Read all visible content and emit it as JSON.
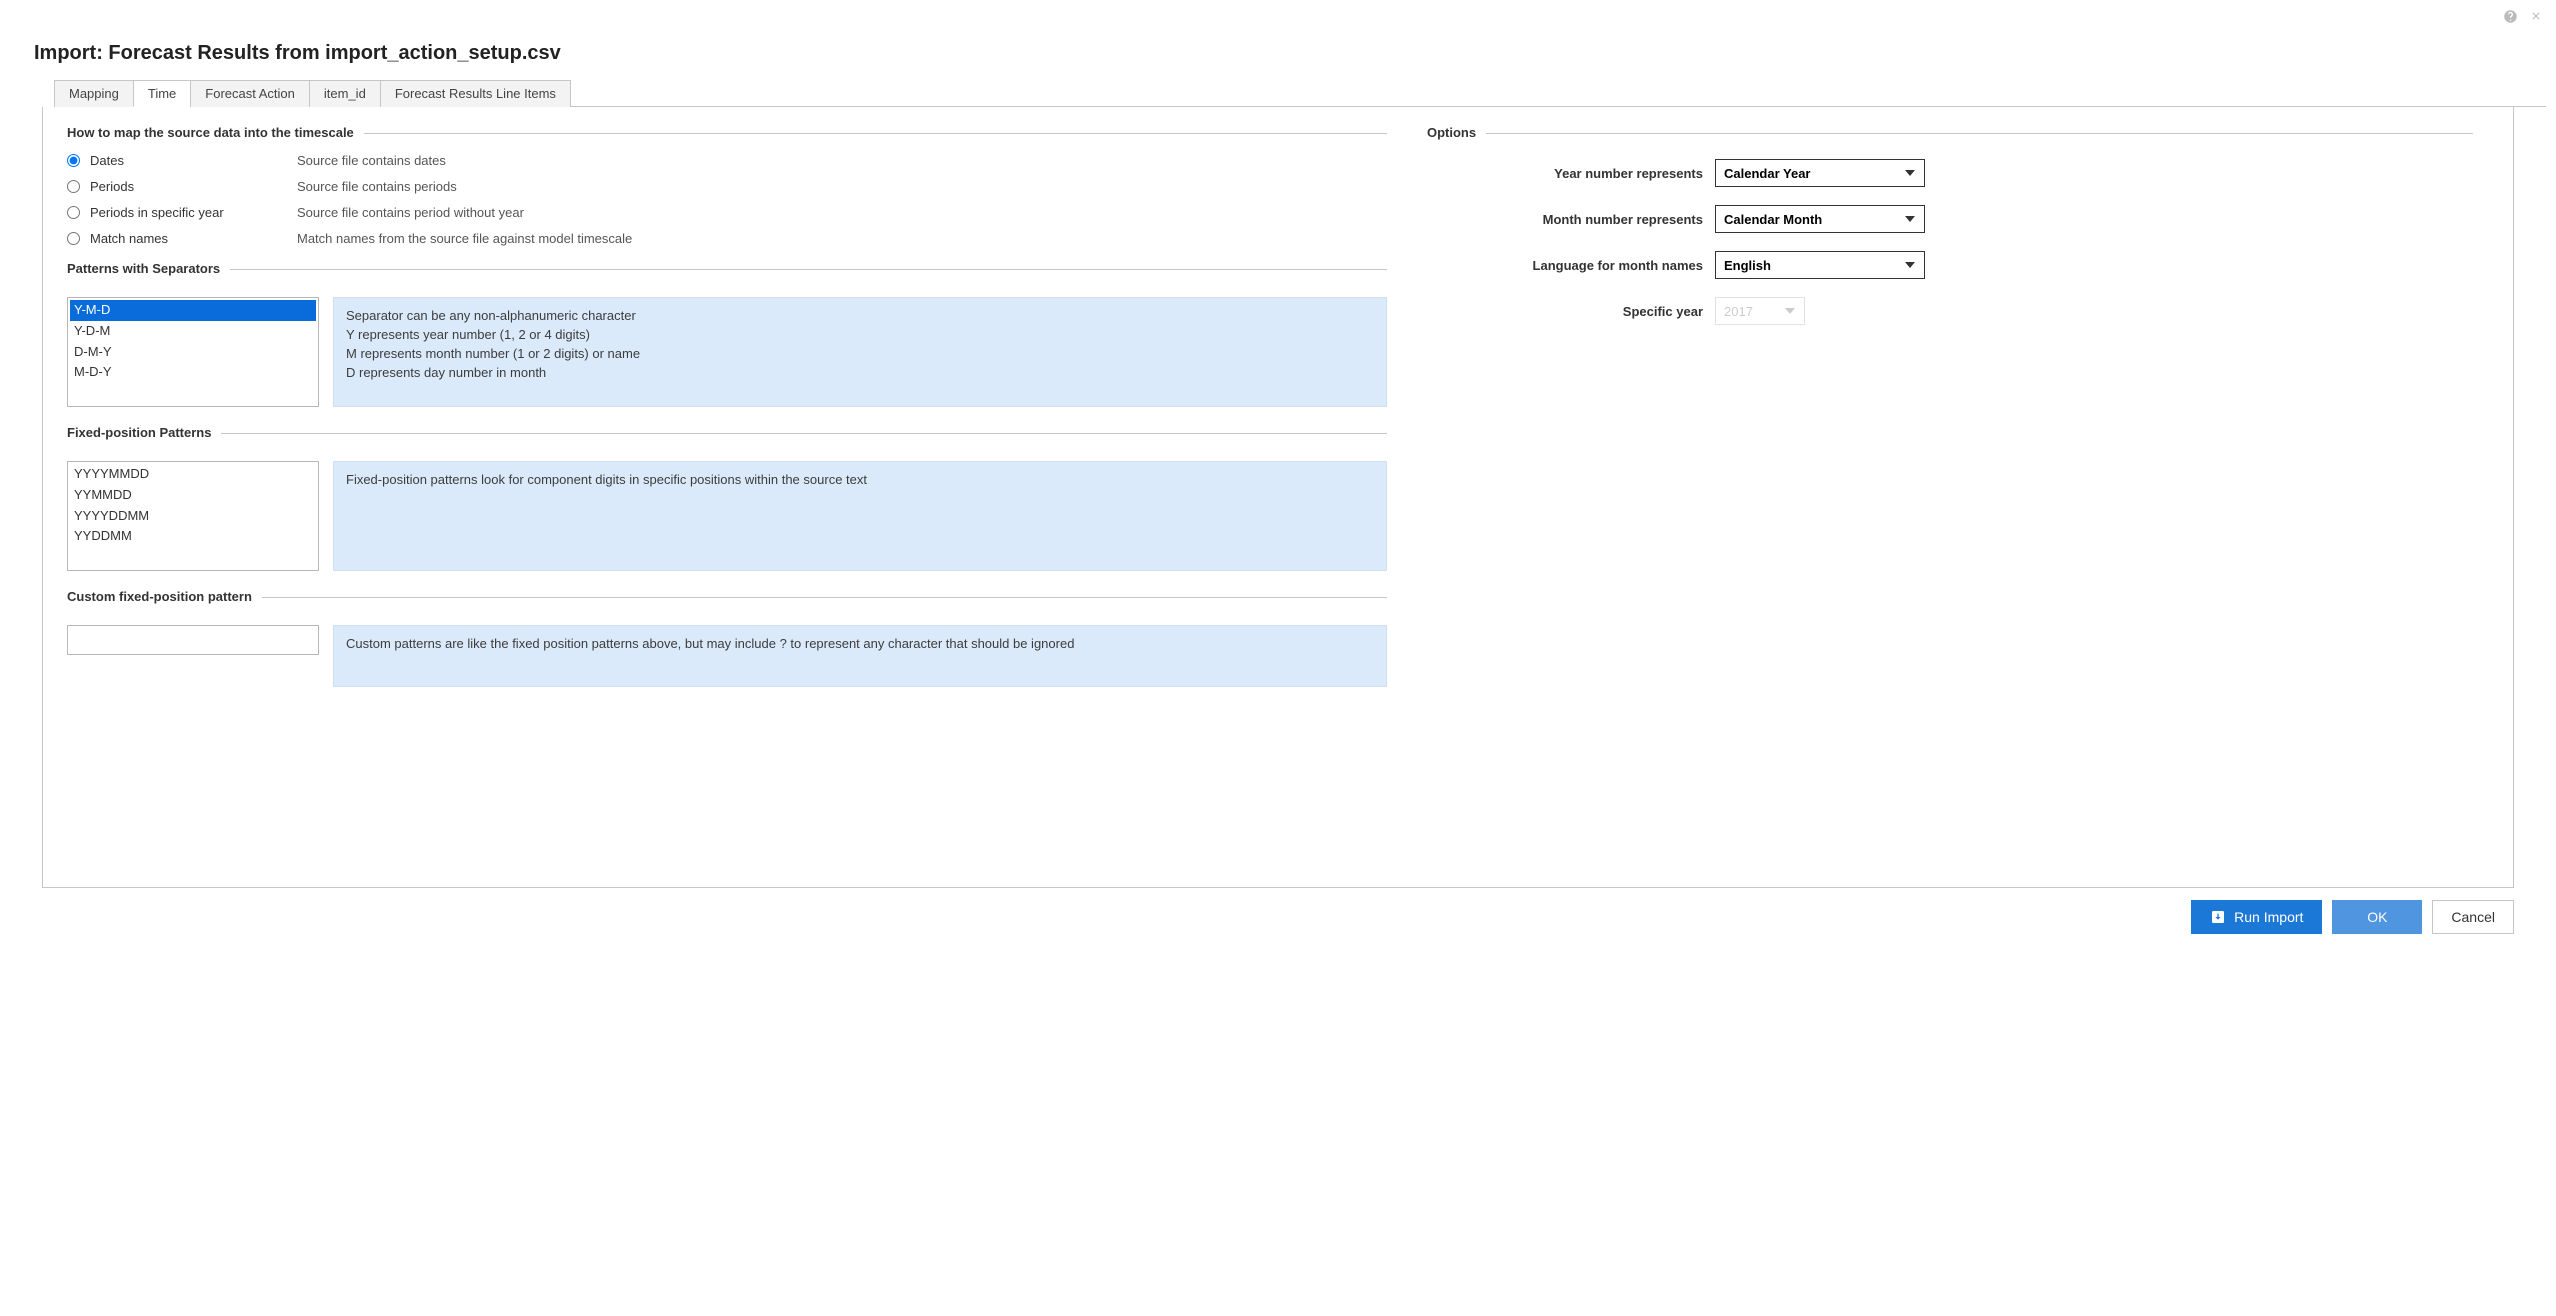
{
  "header": {
    "title": "Import: Forecast Results from import_action_setup.csv"
  },
  "tabs": {
    "items": [
      {
        "label": "Mapping"
      },
      {
        "label": "Time"
      },
      {
        "label": "Forecast Action"
      },
      {
        "label": "item_id"
      },
      {
        "label": "Forecast Results Line Items"
      }
    ],
    "activeIndex": 1
  },
  "mapSection": {
    "legend": "How to map the source data into the timescale",
    "rows": [
      {
        "label": "Dates",
        "desc": "Source file contains dates",
        "checked": true
      },
      {
        "label": "Periods",
        "desc": "Source file contains periods",
        "checked": false
      },
      {
        "label": "Periods in specific year",
        "desc": "Source file contains period without year",
        "checked": false
      },
      {
        "label": "Match names",
        "desc": "Match names from the source file against model timescale",
        "checked": false
      }
    ]
  },
  "patternsSep": {
    "title": "Patterns with Separators",
    "options": [
      "Y-M-D",
      "Y-D-M",
      "D-M-Y",
      "M-D-Y"
    ],
    "selected": "Y-M-D",
    "help": {
      "l1": "Separator can be any non-alphanumeric character",
      "l2": "Y represents year number (1, 2 or 4 digits)",
      "l3": "M represents month number (1 or 2 digits) or name",
      "l4": "D represents day number in month"
    }
  },
  "fixedPos": {
    "title": "Fixed-position Patterns",
    "options": [
      "YYYYMMDD",
      "YYMMDD",
      "YYYYDDMM",
      "YYDDMM"
    ],
    "help": "Fixed-position patterns look for component digits in specific positions within the source text"
  },
  "custom": {
    "title": "Custom fixed-position pattern",
    "value": "",
    "help": "Custom patterns are like the fixed position patterns above, but may include ? to represent any character that should be ignored"
  },
  "options": {
    "legend": "Options",
    "rows": {
      "year": {
        "label": "Year number represents",
        "value": "Calendar Year"
      },
      "month": {
        "label": "Month number represents",
        "value": "Calendar Month"
      },
      "lang": {
        "label": "Language for month names",
        "value": "English"
      },
      "specYear": {
        "label": "Specific year",
        "value": "2017"
      }
    }
  },
  "footer": {
    "run": "Run Import",
    "ok": "OK",
    "cancel": "Cancel"
  }
}
